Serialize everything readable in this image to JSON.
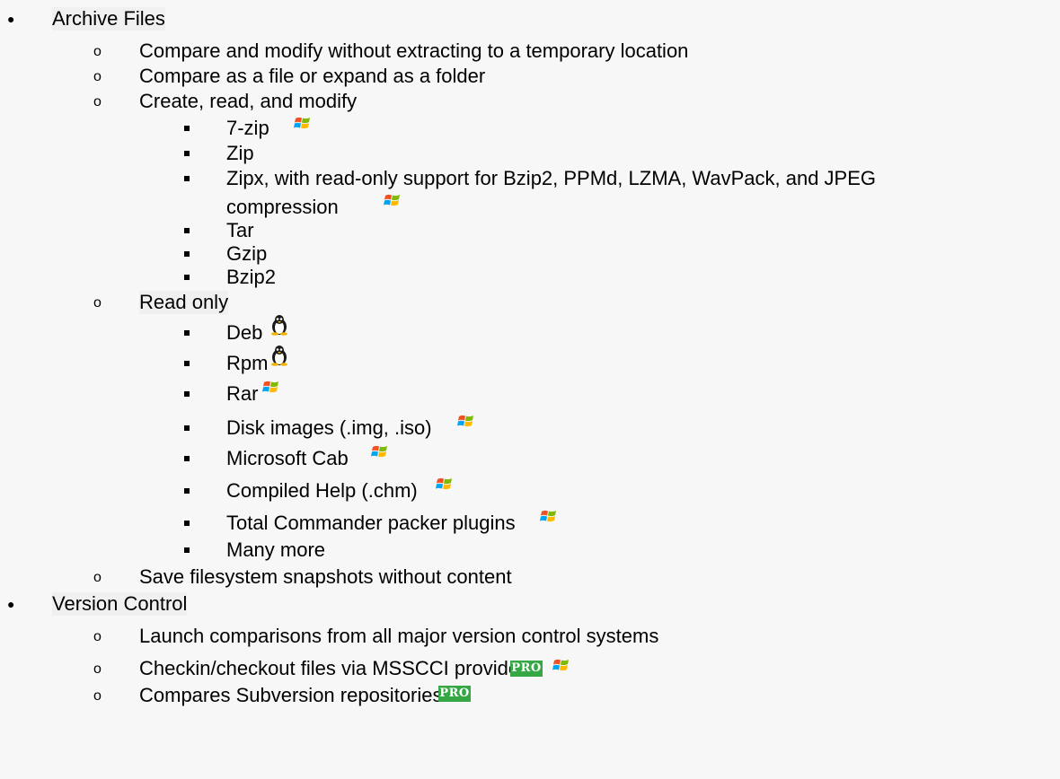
{
  "sections": [
    {
      "title": "Archive Files",
      "items": [
        {
          "text": "Compare and modify without extracting to a temporary location"
        },
        {
          "text": "Compare as a file or expand as a folder"
        },
        {
          "text": "Create, read, and modify",
          "subitems": [
            {
              "text": "7-zip",
              "icons": [
                "windows-icon"
              ]
            },
            {
              "text": "Zip"
            },
            {
              "text": "Zipx, with read-only support for Bzip2, PPMd, LZMA, WavPack, and JPEG",
              "continuation": "compression",
              "icons": [
                "windows-icon"
              ]
            },
            {
              "text": "Tar"
            },
            {
              "text": "Gzip"
            },
            {
              "text": "Bzip2"
            }
          ]
        },
        {
          "text": "Read only",
          "subitems": [
            {
              "text": "Deb",
              "icons": [
                "linux-icon"
              ]
            },
            {
              "text": "Rpm",
              "icons": [
                "linux-icon"
              ]
            },
            {
              "text": "Rar",
              "icons": [
                "windows-icon"
              ]
            },
            {
              "text": "Disk images (.img, .iso)",
              "icons": [
                "windows-icon"
              ]
            },
            {
              "text": "Microsoft Cab",
              "icons": [
                "windows-icon"
              ]
            },
            {
              "text": "Compiled Help (.chm)",
              "icons": [
                "windows-icon"
              ]
            },
            {
              "text": "Total Commander packer plugins",
              "icons": [
                "windows-icon"
              ]
            },
            {
              "text": "Many more"
            }
          ]
        },
        {
          "text": "Save filesystem snapshots without content"
        }
      ]
    },
    {
      "title": "Version Control",
      "items": [
        {
          "text": "Launch comparisons from all major version control systems"
        },
        {
          "text": "Checkin/checkout files via MSSCCI provider",
          "icons": [
            "pro-badge",
            "windows-icon"
          ]
        },
        {
          "text": "Compares Subversion repositories",
          "icons": [
            "pro-badge"
          ]
        }
      ]
    }
  ],
  "badge": {
    "pro_label": "PRO"
  },
  "colors": {
    "pro_badge": "#35a845",
    "background": "#f7f7f7"
  }
}
